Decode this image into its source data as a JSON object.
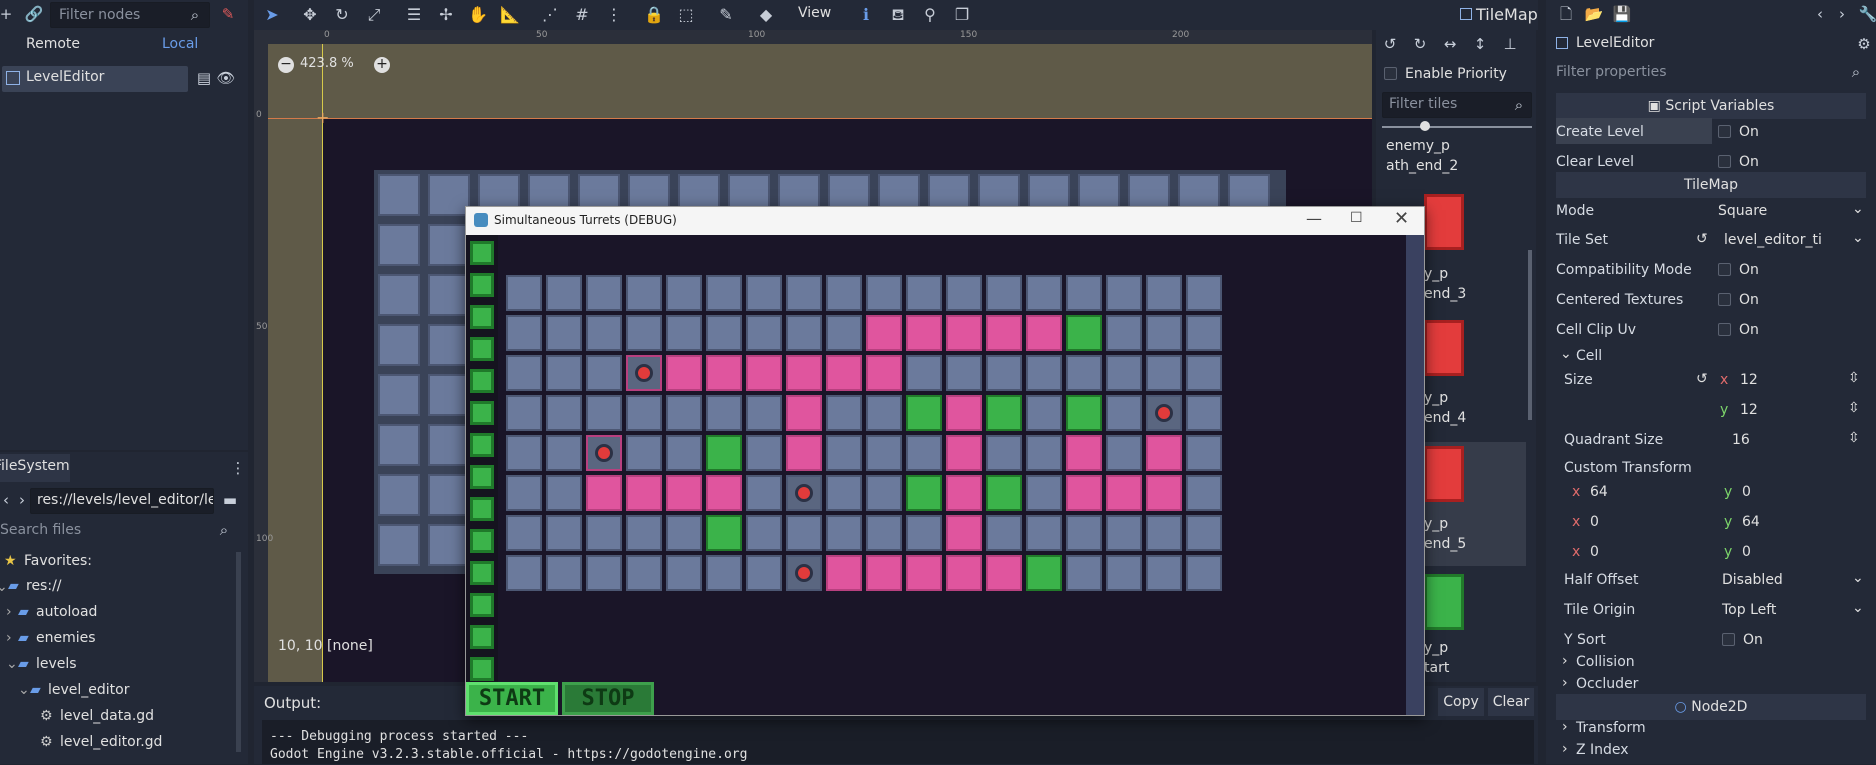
{
  "scene_panel": {
    "filter_placeholder": "Filter nodes",
    "tab_remote": "Remote",
    "tab_local": "Local",
    "node": "LevelEditor"
  },
  "filesystem": {
    "tab": "FileSystem",
    "path": "res://levels/level_editor/le",
    "search_placeholder": "Search files",
    "favorites": "Favorites:",
    "items": [
      "res://",
      "autoload",
      "enemies",
      "levels",
      "level_editor",
      "level_data.gd",
      "level_editor.gd"
    ]
  },
  "toolbar": {
    "view": "View",
    "tilemap": "TileMap"
  },
  "viewport": {
    "zoom": "423.8 %",
    "coord": "10, 10 [none]",
    "ruler_top": [
      "0",
      "50",
      "100",
      "150",
      "200"
    ],
    "ruler_left": [
      "0",
      "50",
      "100"
    ]
  },
  "tile_panel": {
    "enable_priority": "Enable Priority",
    "filter_placeholder": "Filter tiles",
    "tiles": [
      "enemy_p\nath_end_2",
      "y_p\nend_3",
      "y_p\nend_4",
      "y_p\nend_5",
      "y_p\ntart"
    ]
  },
  "debug_window": {
    "title": "Simultaneous Turrets (DEBUG)",
    "start": "START",
    "stop": "STOP"
  },
  "output": {
    "label": "Output:",
    "copy": "Copy",
    "clear": "Clear",
    "lines": [
      "--- Debugging process started ---",
      "Godot Engine v3.2.3.stable.official - https://godotengine.org"
    ]
  },
  "inspector": {
    "node": "LevelEditor",
    "filter_placeholder": "Filter properties",
    "script_vars": "Script Variables",
    "create_level": "Create Level",
    "clear_level": "Clear Level",
    "on": "On",
    "tilemap": "TileMap",
    "mode_label": "Mode",
    "mode": "Square",
    "tileset_label": "Tile Set",
    "tileset": "level_editor_ti",
    "compat": "Compatibility Mode",
    "centered": "Centered Textures",
    "clip": "Cell Clip Uv",
    "cell": "Cell",
    "size": "Size",
    "size_x": "12",
    "size_y": "12",
    "quadrant": "Quadrant Size",
    "quadrant_val": "16",
    "custom_transform": "Custom Transform",
    "t": [
      "64",
      "0",
      "0",
      "64",
      "0",
      "0"
    ],
    "half_offset": "Half Offset",
    "half_offset_val": "Disabled",
    "tile_origin": "Tile Origin",
    "tile_origin_val": "Top Left",
    "ysort": "Y Sort",
    "collision": "Collision",
    "occluder": "Occluder",
    "node2d": "Node2D",
    "transform": "Transform",
    "zindex": "Z Index"
  },
  "colors": {
    "accent": "#699ce8",
    "path": "#e0559e",
    "grass": "#3bb34a",
    "turret": "#e23b3b",
    "tile": "#6b7a9c"
  }
}
